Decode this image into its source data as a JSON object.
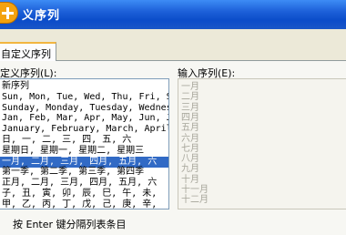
{
  "window": {
    "title": "义序列"
  },
  "tab": {
    "label": "自定义序列"
  },
  "custom_list": {
    "label": "定义序列(L):",
    "items": [
      "新序列",
      "Sun, Mon, Tue, Wed, Thu, Fri, S",
      "Sunday, Monday, Tuesday, Wednes",
      "Jan, Feb, Mar, Apr, May, Jun, J",
      "January, February, March, April",
      "日, 一, 二, 三, 四, 五, 六",
      "星期日, 星期一, 星期二, 星期三",
      "一月, 二月, 三月, 四月, 五月, 六",
      "第一季, 第二季, 第三季, 第四季",
      "正月, 二月, 三月, 四月, 五月, 六",
      "子, 丑, 寅, 卯, 辰, 巳, 午, 未,",
      "甲, 乙, 丙, 丁, 戊, 己, 庚, 辛,"
    ],
    "selected_index": 7
  },
  "entries": {
    "label": "输入序列(E):",
    "items": [
      "一月",
      "二月",
      "三月",
      "四月",
      "五月",
      "六月",
      "七月",
      "八月",
      "九月",
      "十月",
      "十一月",
      "十二月"
    ]
  },
  "hint": "按 Enter 键分隔列表条目",
  "colors": {
    "selection": "#316ac5",
    "titlebar": "#0b4cc9",
    "disabled_text": "#a6a59a"
  }
}
